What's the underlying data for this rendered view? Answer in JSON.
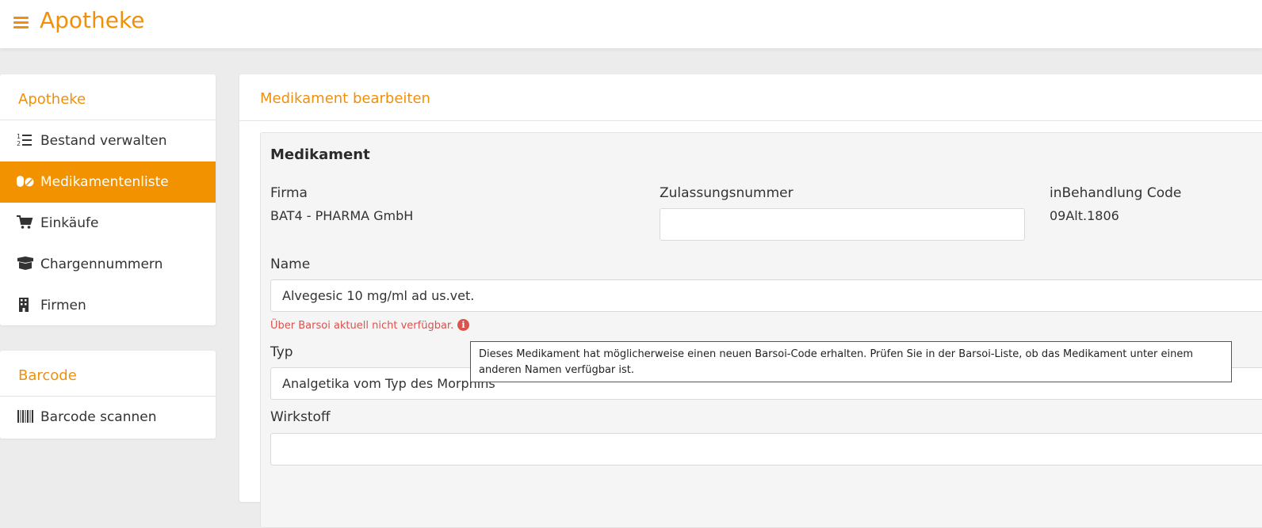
{
  "header": {
    "title": "Apotheke",
    "menu_icon": "hamburger-menu-icon"
  },
  "sidebar": {
    "section1": {
      "title": "Apotheke",
      "items": [
        {
          "label": "Bestand verwalten",
          "icon": "numbered-list-icon",
          "active": false
        },
        {
          "label": "Medikamentenliste",
          "icon": "pills-icon",
          "active": true
        },
        {
          "label": "Einkäufe",
          "icon": "shopping-cart-icon",
          "active": false
        },
        {
          "label": "Chargennummern",
          "icon": "box-open-icon",
          "active": false
        },
        {
          "label": "Firmen",
          "icon": "building-icon",
          "active": false
        }
      ]
    },
    "section2": {
      "title": "Barcode",
      "items": [
        {
          "label": "Barcode scannen",
          "icon": "barcode-icon",
          "active": false
        }
      ]
    }
  },
  "main": {
    "title": "Medikament bearbeiten",
    "section_title": "Medikament",
    "firma": {
      "label": "Firma",
      "value": "BAT4 - PHARMA GmbH"
    },
    "zulassungsnummer": {
      "label": "Zulassungsnummer",
      "value": ""
    },
    "inbehandlung": {
      "label": "inBehandlung Code",
      "value": "09Alt.1806"
    },
    "name": {
      "label": "Name",
      "value": "Alvegesic 10 mg/ml ad us.vet."
    },
    "name_warning": "Über Barsoi aktuell nicht verfügbar.",
    "typ": {
      "label": "Typ",
      "value": "Analgetika vom Typ des Morphins"
    },
    "wirkstoff": {
      "label": "Wirkstoff",
      "value": ""
    }
  },
  "tooltip": {
    "text": "Dieses Medikament hat möglicherweise einen neuen Barsoi-Code erhalten. Prüfen Sie in der Barsoi-Liste, ob das Medikament unter einem anderen Namen verfügbar ist."
  },
  "colors": {
    "accent": "#f39200",
    "warning": "#d9534f",
    "background": "#ececed"
  }
}
